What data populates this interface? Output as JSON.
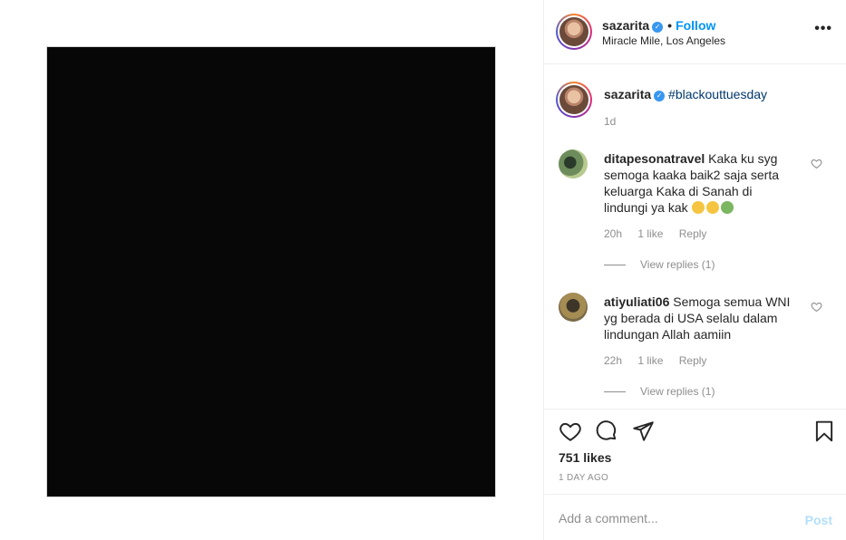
{
  "post": {
    "username": "sazarita",
    "follow_label": "Follow",
    "separator": "•",
    "location": "Miracle Mile, Los Angeles",
    "more_label": "•••"
  },
  "caption": {
    "username": "sazarita",
    "hashtag": "#blackouttuesday",
    "time": "1d"
  },
  "comments": [
    {
      "username": "ditapesonatravel",
      "text": "Kaka ku syg semoga kaaka baik2 saja serta keluarga Kaka di Sanah di lindungi ya kak",
      "time": "20h",
      "likes": "1 like",
      "reply_label": "Reply",
      "view_replies": "View replies (1)"
    },
    {
      "username": "atiyuliati06",
      "text": "Semoga semua WNI yg berada di USA selalu dalam lindungan Allah aamiin",
      "time": "22h",
      "likes": "1 like",
      "reply_label": "Reply",
      "view_replies": "View replies (1)"
    }
  ],
  "actions": {
    "likes": "751 likes",
    "posted_ago": "1 DAY AGO"
  },
  "comment_box": {
    "placeholder": "Add a comment...",
    "post_label": "Post"
  },
  "icons": {
    "verified": "verified-badge-icon",
    "heart": "heart-icon",
    "comment": "comment-icon",
    "share": "paper-plane-icon",
    "save": "bookmark-icon"
  },
  "colors": {
    "accent": "#0095f6",
    "hashtag": "#00376b",
    "muted": "#8e8e8e",
    "post_disabled": "#b2dffc",
    "image_fill": "#070707"
  }
}
